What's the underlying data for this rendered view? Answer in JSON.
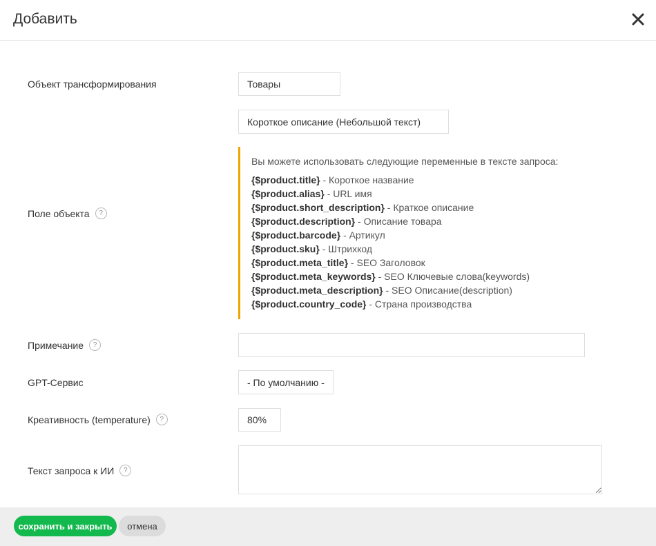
{
  "dialog": {
    "title": "Добавить",
    "close_icon": "close-icon"
  },
  "form": {
    "transform_object": {
      "label": "Объект трансформирования",
      "value": "Товары"
    },
    "object_field": {
      "label": "Поле объекта",
      "value": "Короткое описание (Небольшой текст)",
      "info_intro": "Вы можете использовать следующие переменные в тексте запроса:",
      "variables": [
        {
          "name": "{$product.title}",
          "desc": " - Короткое название"
        },
        {
          "name": "{$product.alias}",
          "desc": " - URL имя"
        },
        {
          "name": "{$product.short_description}",
          "desc": " - Краткое описание"
        },
        {
          "name": "{$product.description}",
          "desc": " - Описание товара"
        },
        {
          "name": "{$product.barcode}",
          "desc": " - Артикул"
        },
        {
          "name": "{$product.sku}",
          "desc": " - Штрихкод"
        },
        {
          "name": "{$product.meta_title}",
          "desc": " - SEO Заголовок"
        },
        {
          "name": "{$product.meta_keywords}",
          "desc": " - SEO Ключевые слова(keywords)"
        },
        {
          "name": "{$product.meta_description}",
          "desc": " - SEO Описание(description)"
        },
        {
          "name": "{$product.country_code}",
          "desc": " - Страна производства"
        }
      ]
    },
    "note": {
      "label": "Примечание",
      "value": ""
    },
    "gpt_service": {
      "label": "GPT-Сервис",
      "value": "- По умолчанию -"
    },
    "temperature": {
      "label": "Креативность (temperature)",
      "value": "80%"
    },
    "prompt": {
      "label": "Текст запроса к ИИ",
      "value": ""
    },
    "help_glyph": "?"
  },
  "footer": {
    "save_label": "сохранить и закрыть",
    "cancel_label": "отмена"
  },
  "colors": {
    "accent_green": "#13b94d",
    "info_border": "#f0a400"
  }
}
